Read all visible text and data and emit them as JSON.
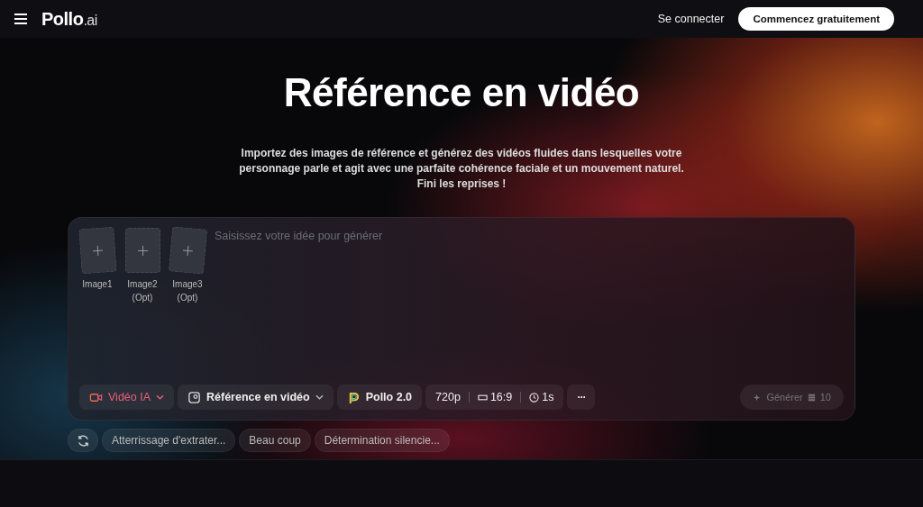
{
  "header": {
    "logo": {
      "name": "Pollo",
      "suffix": ".ai"
    },
    "login": "Se connecter",
    "cta": "Commencez gratuitement"
  },
  "hero": {
    "title": "Référence en vidéo",
    "subtitle": "Importez des images de référence et générez des vidéos fluides dans lesquelles votre personnage parle et agit avec une parfaite cohérence faciale et un mouvement naturel. Fini les reprises !"
  },
  "prompt": {
    "uploads": [
      {
        "label": "Image1"
      },
      {
        "label": "Image2 (Opt)"
      },
      {
        "label": "Image3 (Opt)"
      }
    ],
    "placeholder": "Saisissez votre idée pour générer",
    "toolbar": [
      {
        "kind": "mode",
        "label": "Vidéo IA"
      },
      {
        "kind": "feature",
        "label": "Référence en vidéo"
      },
      {
        "kind": "model",
        "label": "Pollo 2.0"
      },
      {
        "kind": "settings",
        "items": [
          {
            "kind": "text",
            "label": "720p"
          },
          {
            "kind": "ratio",
            "label": "16:9"
          },
          {
            "kind": "clock",
            "label": "1s"
          }
        ]
      },
      {
        "kind": "more",
        "label": "···"
      }
    ],
    "generate": {
      "label": "Générer",
      "credits": "10",
      "disabled": true
    }
  },
  "suggestions": [
    "Atterrissage d'extrater...",
    "Beau coup",
    "Détermination silencie..."
  ]
}
